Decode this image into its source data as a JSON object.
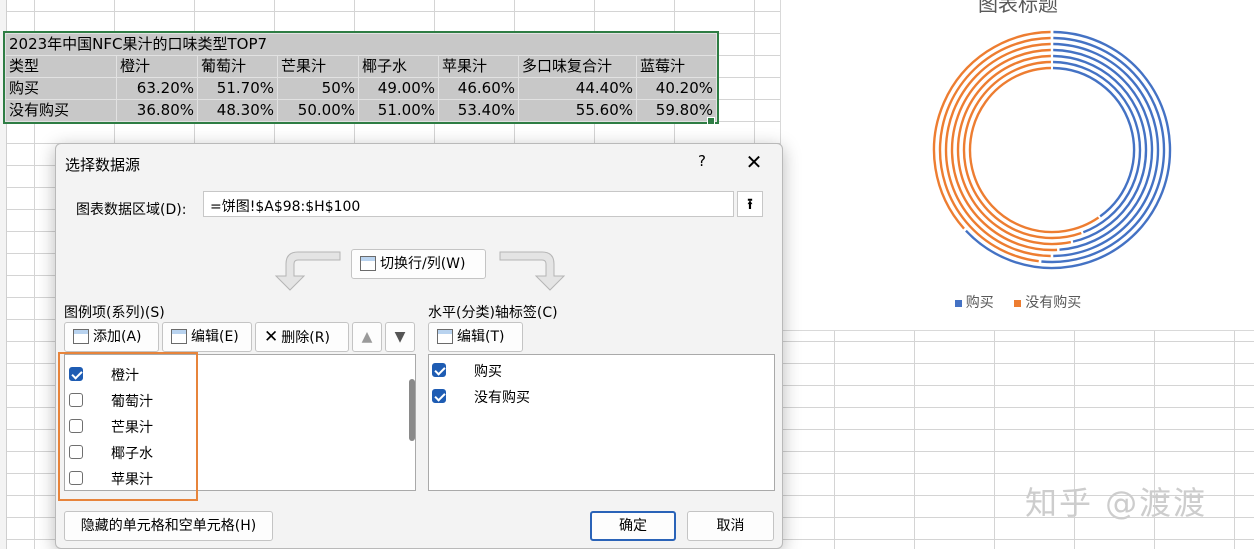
{
  "sheet": {
    "table_title": "2023年中国NFC果汁的口味类型TOP7",
    "header": [
      "类型",
      "橙汁",
      "葡萄汁",
      "芒果汁",
      "椰子水",
      "苹果汁",
      "多口味复合汁",
      "蓝莓汁"
    ],
    "rows": [
      [
        "购买",
        "63.20%",
        "51.70%",
        "50%",
        "49.00%",
        "46.60%",
        "44.40%",
        "40.20%"
      ],
      [
        "没有购买",
        "36.80%",
        "48.30%",
        "50.00%",
        "51.00%",
        "53.40%",
        "55.60%",
        "59.80%"
      ]
    ]
  },
  "chart": {
    "title": "图表标题",
    "legend": [
      {
        "label": "购买",
        "color": "#4472c4"
      },
      {
        "label": "没有购买",
        "color": "#ed7d31"
      }
    ]
  },
  "chart_data": {
    "type": "pie",
    "subtype": "doughnut",
    "title": "图表标题",
    "categories": [
      "购买",
      "没有购买"
    ],
    "series": [
      {
        "name": "橙汁",
        "values": [
          0.632,
          0.368
        ]
      },
      {
        "name": "葡萄汁",
        "values": [
          0.517,
          0.483
        ]
      },
      {
        "name": "芒果汁",
        "values": [
          0.5,
          0.5
        ]
      },
      {
        "name": "椰子水",
        "values": [
          0.49,
          0.51
        ]
      },
      {
        "name": "苹果汁",
        "values": [
          0.466,
          0.534
        ]
      },
      {
        "name": "多口味复合汁",
        "values": [
          0.444,
          0.556
        ]
      },
      {
        "name": "蓝莓汁",
        "values": [
          0.402,
          0.598
        ]
      }
    ],
    "colors": [
      "#4472c4",
      "#ed7d31"
    ],
    "legend_position": "bottom"
  },
  "dialog": {
    "title": "选择数据源",
    "help": "?",
    "close": "✕",
    "range_label": "图表数据区域(D):",
    "range_value": "=饼图!$A$98:$H$100",
    "switch_label": "切换行/列(W)",
    "legend_section": "图例项(系列)(S)",
    "axis_section": "水平(分类)轴标签(C)",
    "add_label": "添加(A)",
    "edit_label": "编辑(E)",
    "delete_label": "删除(R)",
    "up": "▲",
    "down": "▼",
    "axis_edit_label": "编辑(T)",
    "series_items": [
      {
        "label": "橙汁",
        "checked": true
      },
      {
        "label": "葡萄汁",
        "checked": false
      },
      {
        "label": "芒果汁",
        "checked": false
      },
      {
        "label": "椰子水",
        "checked": false
      },
      {
        "label": "苹果汁",
        "checked": false
      }
    ],
    "axis_items": [
      {
        "label": "购买",
        "checked": true
      },
      {
        "label": "没有购买",
        "checked": true
      }
    ],
    "hidden_cells_label": "隐藏的单元格和空单元格(H)",
    "ok_label": "确定",
    "cancel_label": "取消"
  },
  "watermark": "知乎 @渡渡"
}
